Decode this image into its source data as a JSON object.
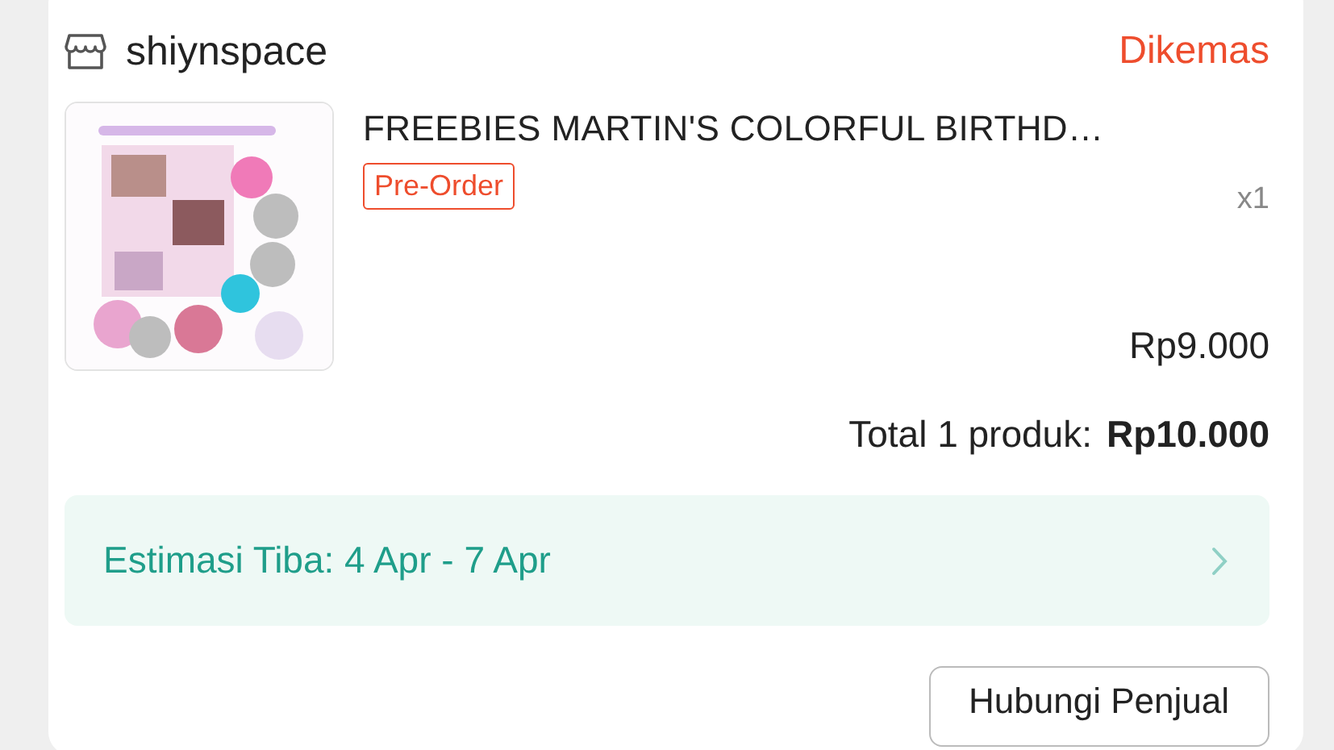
{
  "shop": {
    "name": "shiynspace"
  },
  "status": "Dikemas",
  "product": {
    "title": "FREEBIES MARTIN'S COLORFUL BIRTHD…",
    "tag": "Pre-Order",
    "quantity": "x1",
    "price": "Rp9.000"
  },
  "total": {
    "label": "Total 1 produk:",
    "amount": "Rp10.000"
  },
  "delivery": {
    "text": "Estimasi Tiba: 4 Apr - 7 Apr"
  },
  "buttons": [
    "Hubungi Penjual"
  ]
}
